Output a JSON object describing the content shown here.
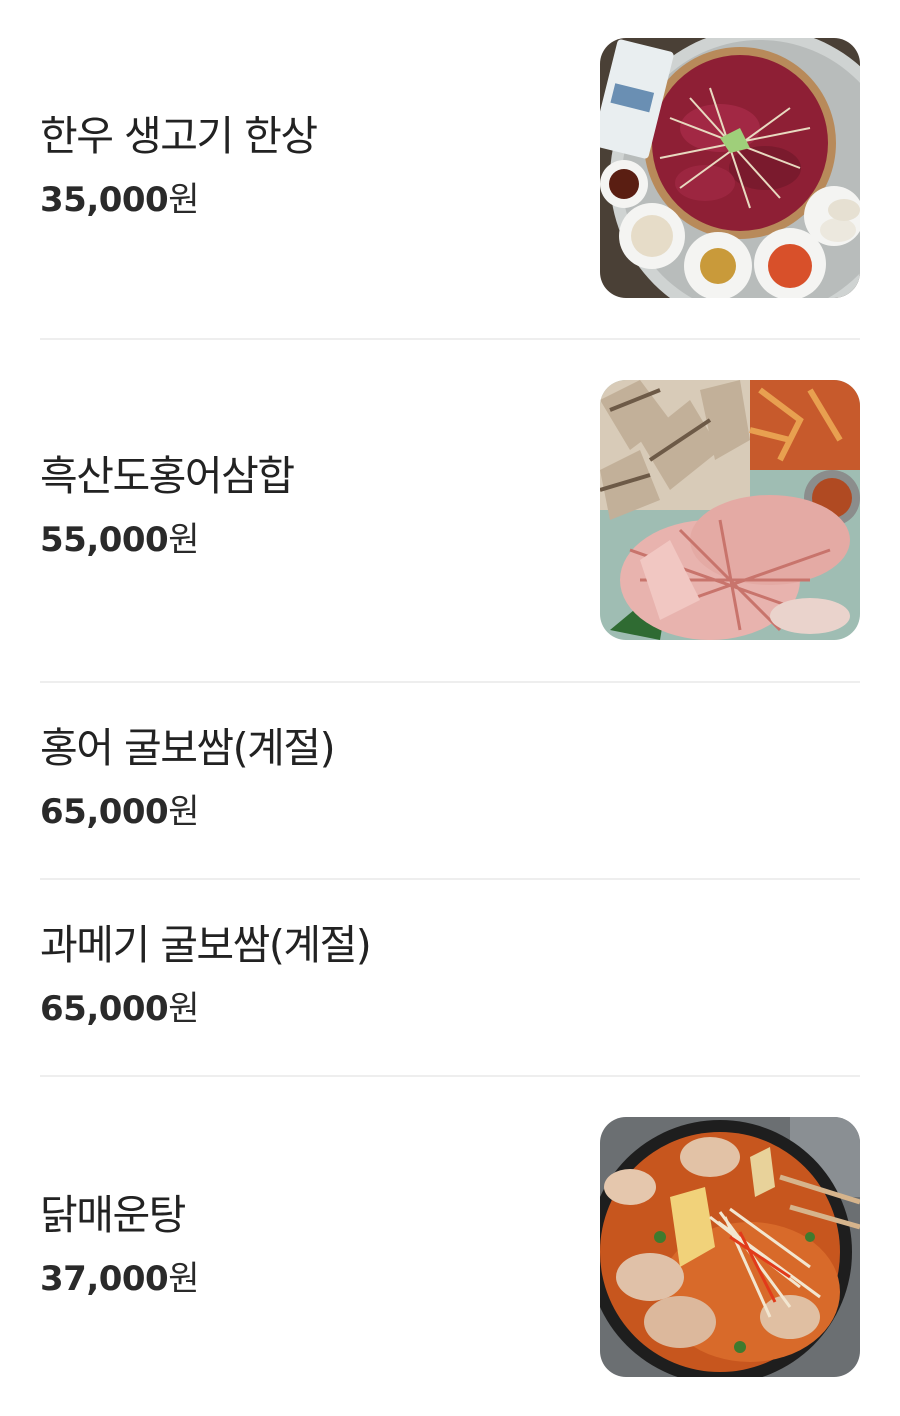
{
  "menu": {
    "items": [
      {
        "name": "한우 생고기 한상",
        "price": "35,000",
        "unit": "원",
        "photo": "raw-beef-platter-photo"
      },
      {
        "name": "흑산도홍어삼합",
        "price": "55,000",
        "unit": "원",
        "photo": "skate-pork-kimchi-photo"
      },
      {
        "name": "홍어 굴보쌈(계절)",
        "price": "65,000",
        "unit": "원"
      },
      {
        "name": "과메기 굴보쌈(계절)",
        "price": "65,000",
        "unit": "원"
      },
      {
        "name": "닭매운탕",
        "price": "37,000",
        "unit": "원",
        "photo": "spicy-chicken-stew-photo"
      }
    ]
  },
  "colors": {
    "text": "#222222",
    "divider": "#eeeeee",
    "background": "#ffffff"
  }
}
